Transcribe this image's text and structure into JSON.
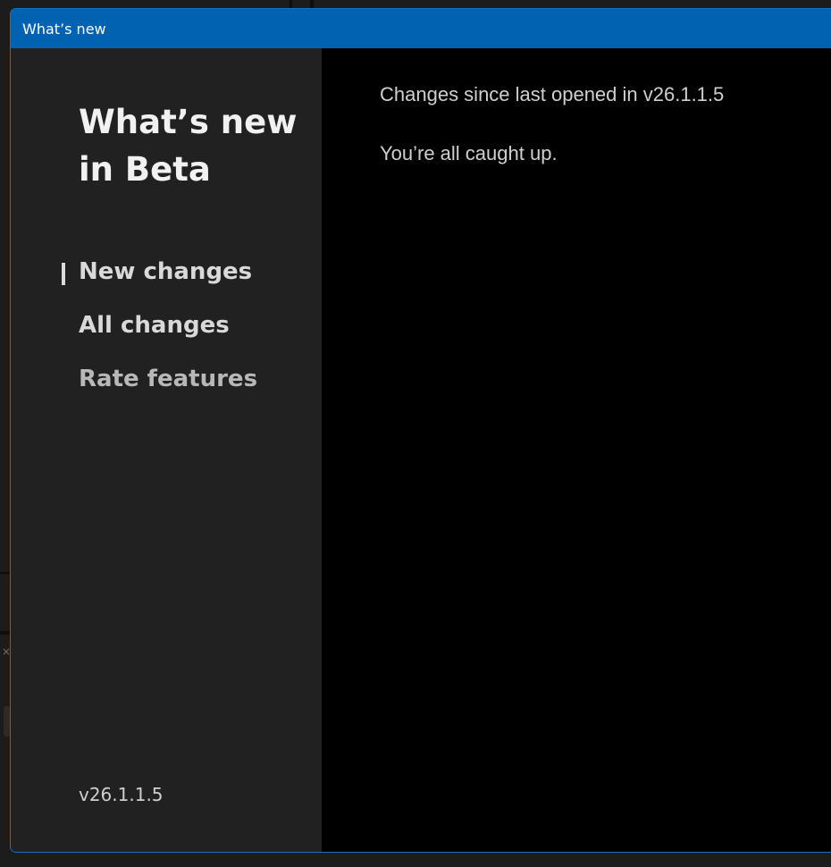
{
  "window": {
    "title": "What’s new"
  },
  "sidebar": {
    "heading": "What’s new in Beta",
    "items": [
      {
        "label": "New changes",
        "active": true
      },
      {
        "label": "All changes",
        "active": false
      },
      {
        "label": "Rate features",
        "active": false
      }
    ],
    "version": "v26.1.1.5"
  },
  "main": {
    "heading": "Changes since last opened in v26.1.1.5",
    "message": "You’re all caught up."
  },
  "background": {
    "close_glyph": "×"
  },
  "colors": {
    "titlebar": "#0062b1",
    "dialog_border": "#1473c5",
    "sidebar": "#212121",
    "content": "#000000"
  }
}
